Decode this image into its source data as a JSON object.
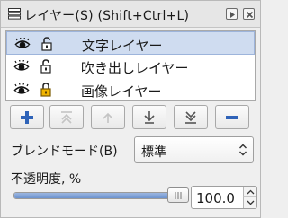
{
  "panel": {
    "title": "レイヤー(S) (Shift+Ctrl+L)",
    "title_icon": "layers-icon",
    "title_buttons": [
      "pin-icon",
      "close-icon"
    ]
  },
  "layers": [
    {
      "name": "文字レイヤー",
      "visible": true,
      "locked": false,
      "selected": true
    },
    {
      "name": "吹き出しレイヤー",
      "visible": true,
      "locked": false,
      "selected": false
    },
    {
      "name": "画像レイヤー",
      "visible": true,
      "locked": true,
      "selected": false
    }
  ],
  "toolbar": {
    "buttons": [
      {
        "icon": "add-icon",
        "enabled": true
      },
      {
        "icon": "move-to-top-icon",
        "enabled": false
      },
      {
        "icon": "move-up-icon",
        "enabled": false
      },
      {
        "icon": "move-down-icon",
        "enabled": true
      },
      {
        "icon": "move-to-bottom-icon",
        "enabled": true
      },
      {
        "icon": "remove-icon",
        "enabled": true
      }
    ]
  },
  "blend_mode": {
    "label": "ブレンドモード(B)",
    "value": "標準"
  },
  "opacity": {
    "label": "不透明度, %",
    "value": "100.0",
    "level_percent": 100
  },
  "colors": {
    "selection": "#cfdcf0",
    "accent": "#2f63b8",
    "lock": "#d99a00"
  }
}
